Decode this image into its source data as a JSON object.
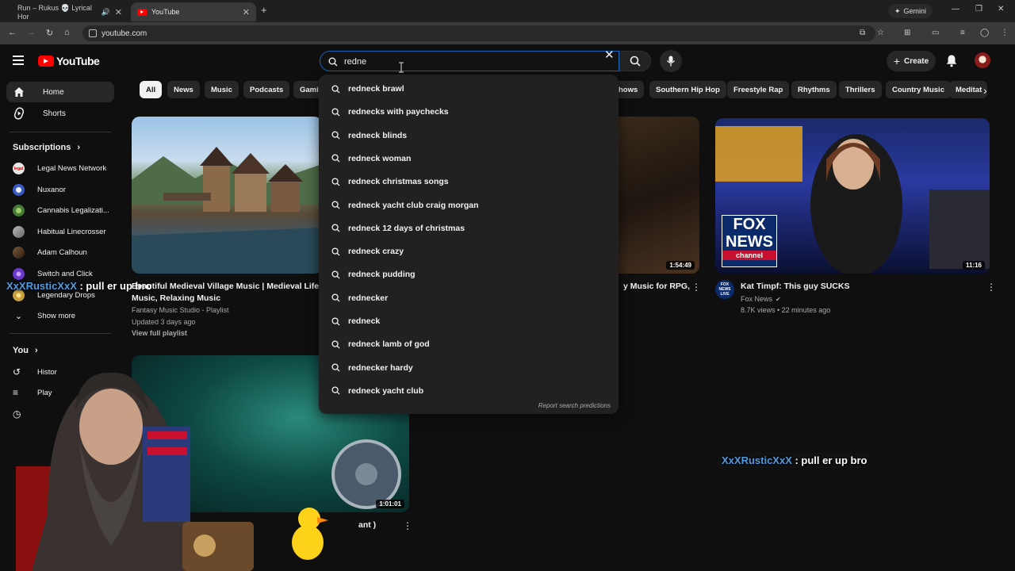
{
  "browser": {
    "tabs": [
      {
        "title": "Run – Rukus 💀 Lyrical Hor",
        "active": false
      },
      {
        "title": "YouTube",
        "active": true
      }
    ],
    "gemini_label": "Gemini",
    "url": "youtube.com"
  },
  "masthead": {
    "logo_text": "YouTube",
    "search_value": "redne",
    "create_label": "Create"
  },
  "sidebar": {
    "items": [
      {
        "label": "Home",
        "icon": "home-icon",
        "active": true
      },
      {
        "label": "Shorts",
        "icon": "shorts-icon",
        "active": false
      }
    ],
    "subscriptions_title": "Subscriptions",
    "subscriptions": [
      {
        "label": "Legal News Network",
        "color": "#e8e8e8"
      },
      {
        "label": "Nuxanor",
        "color": "#3b59c8"
      },
      {
        "label": "Cannabis Legalizati...",
        "color": "#4a7a3a"
      },
      {
        "label": "Habitual Linecrosser",
        "color": "#9a9a9a"
      },
      {
        "label": "Adam Calhoun",
        "color": "#4a3a2a"
      },
      {
        "label": "Switch and Click",
        "color": "#6a3ac8"
      },
      {
        "label": "Legendary Drops",
        "color": "#c8a040"
      }
    ],
    "show_more": "Show more",
    "you_title": "You",
    "you_items": [
      {
        "label": "Histor"
      },
      {
        "label": "Play"
      }
    ]
  },
  "chips": [
    "All",
    "News",
    "Music",
    "Podcasts",
    "Gami",
    "hows",
    "Southern Hip Hop",
    "Freestyle Rap",
    "Rhythms",
    "Thrillers",
    "Country Music",
    "Meditat"
  ],
  "videos": [
    {
      "title_line1": "Beautiful Medieval Village Music | Medieval Life | M",
      "title_line2": "Music, Relaxing Music",
      "channel": "Fantasy Music Studio - Playlist",
      "meta": "Updated 3 days ago",
      "extra": "View full playlist"
    },
    {
      "title_line1": "y Music for RPG,",
      "duration": "1:54:49"
    },
    {
      "title_line1": "Kat Timpf: This guy SUCKS",
      "channel": "Fox News",
      "meta": "8.7K views • 22 minutes ago",
      "duration": "11:16",
      "logo_top": "FOX",
      "logo_mid": "NEWS",
      "logo_bottom": "channel",
      "badge_text": "FOX NEWS LIVE"
    },
    {
      "title_fragment": "ant )",
      "duration": "1:01:01"
    }
  ],
  "suggestions": [
    "redneck brawl",
    "rednecks with paychecks",
    "redneck blinds",
    "redneck woman",
    "redneck christmas songs",
    "redneck yacht club craig morgan",
    "redneck 12 days of christmas",
    "redneck crazy",
    "redneck pudding",
    "rednecker",
    "redneck",
    "redneck lamb of god",
    "rednecker hardy",
    "redneck yacht club"
  ],
  "report_label": "Report search predictions",
  "chat_overlays": [
    {
      "user": "XxXRusticXxX",
      "message": " : pull er up bro"
    },
    {
      "user": "XxXRusticXxX",
      "message": " : pull er up bro"
    }
  ],
  "colors": {
    "accent_red": "#ff0000",
    "focus_blue": "#1c62b9",
    "chat_user": "#4f9ce6"
  }
}
